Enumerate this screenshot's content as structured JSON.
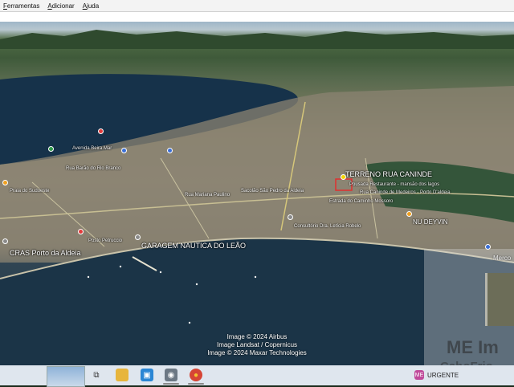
{
  "menu": {
    "items": [
      {
        "label": "Ferramentas"
      },
      {
        "label": "Adicionar"
      },
      {
        "label": "Ajuda"
      }
    ]
  },
  "map": {
    "labels": {
      "terreno": "TERRENO RUA CANINDE",
      "garagem": "GARAGEM NAUTICA DO LEÃO",
      "cras": "CRAS Porto da Aldeia",
      "deyvin": "NU DEYVIN",
      "merco": "Merco",
      "restaurante": "Pousada Restaurante - mansão dos lagos",
      "canindeMedeiros": "Rua Caninde de Medeiros - Porto D'aldeia",
      "consultorio": "Consultório Dra. Letícia Robelo",
      "posto": "Posto Petruccio",
      "caminho": "Estrada do Caminho Mossoro",
      "sacola": "Sacolão São Pedro da Aldeia",
      "rua1": "Rua Mariana Paulino",
      "rua2": "Rua Barão do Rio Branco",
      "rua3": "Avenida Beira Mar",
      "rua4": "Praia do Sudoeste"
    },
    "credits": [
      "Image © 2024 Airbus",
      "Image Landsat / Copernicus",
      "Image © 2024 Maxar Technologies"
    ],
    "watermark": {
      "line1": "ME Im",
      "line2": "CaboFrio"
    }
  },
  "taskbar": {
    "apps": [
      {
        "name": "task-view-icon",
        "glyph": "⧉"
      },
      {
        "name": "file-explorer-icon",
        "glyph": "▬"
      },
      {
        "name": "store-icon",
        "glyph": "▣"
      },
      {
        "name": "google-earth-icon",
        "glyph": "◉"
      },
      {
        "name": "chrome-icon",
        "glyph": "●"
      }
    ],
    "urgent_label": "URGENTE",
    "urgent_badge": "ME"
  },
  "colors": {
    "pin_red": "#e23b3b",
    "pin_blue": "#3b6fd6",
    "pin_green": "#2e9b4a",
    "pin_orange": "#f0a020",
    "pin_gray": "#8a8a8a",
    "selection_red": "#e03030"
  }
}
